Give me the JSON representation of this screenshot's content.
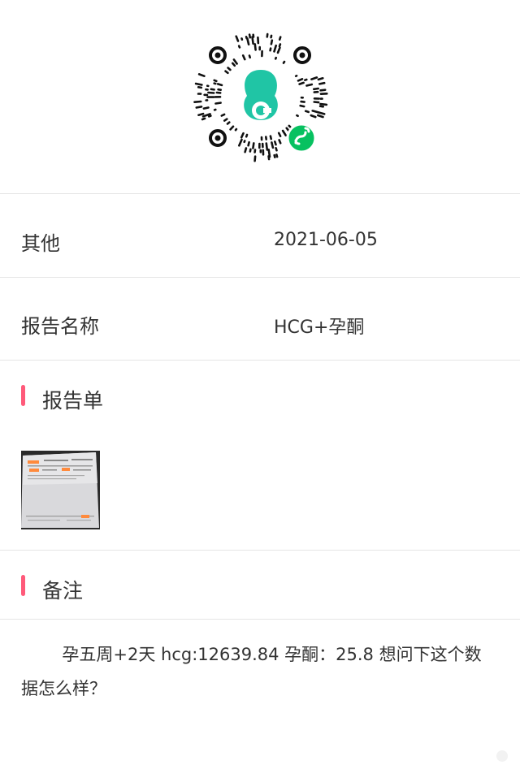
{
  "qr": {
    "icon": "mini-program-qr-code-icon",
    "accent_color": "#20c5a5",
    "badge_color": "#07c160"
  },
  "fields": [
    {
      "label": "其他",
      "value": "2021-06-05"
    },
    {
      "label": "报告名称",
      "value": "HCG+孕酮"
    }
  ],
  "report_section": {
    "title": "报告单",
    "accent_color": "#ff5a7a"
  },
  "remark_section": {
    "title": "备注"
  },
  "remark": {
    "text": "孕五周+2天  hcg:12639.84   孕酮：25.8 想问下这个数据怎么样？"
  }
}
